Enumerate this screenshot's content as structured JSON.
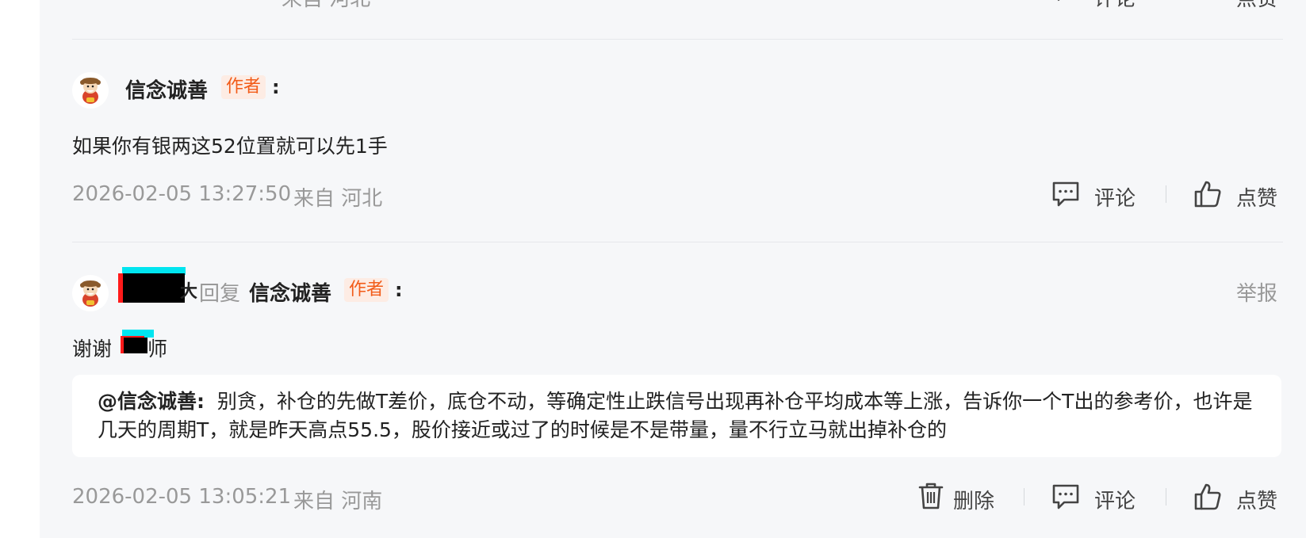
{
  "colors": {
    "badge_text": "#f25c19",
    "badge_bg": "#fdece4",
    "meta_gray": "#999999",
    "panel_bg": "#f6f7f9"
  },
  "top_partial": {
    "location_partial": "来自 河北",
    "comment_label": "评论",
    "like_label": "点赞"
  },
  "comments": [
    {
      "author": "信念诚善",
      "badge": "作者",
      "colon": ":",
      "content": "如果你有银两这52位置就可以先1手",
      "timestamp": "2026-02-05 13:27:50",
      "location": "来自 河北",
      "comment_label": "评论",
      "like_label": "点赞",
      "avatar_icon": "mascot-avatar-icon",
      "comment_icon": "chat-bubble-icon",
      "like_icon": "thumbs-up-icon"
    },
    {
      "author_suffix": "大",
      "reply_word": "回复",
      "reply_to": "信念诚善",
      "badge": "作者",
      "colon": ":",
      "report_label": "举报",
      "content_prefix": "谢谢",
      "content_suffix": "师",
      "quote_author": "@信念诚善:",
      "quote_text": "别贪，补仓的先做T差价，底仓不动，等确定性止跌信号出现再补仓平均成本等上涨，告诉你一个T出的参考价，也许是几天的周期T，就是昨天高点55.5，股价接近或过了的时候是不是带量，量不行立马就出掉补仓的",
      "timestamp": "2026-02-05 13:05:21",
      "location": "来自 河南",
      "delete_label": "删除",
      "comment_label": "评论",
      "like_label": "点赞",
      "avatar_icon": "mascot-avatar-icon",
      "delete_icon": "trash-icon",
      "comment_icon": "chat-bubble-icon",
      "like_icon": "thumbs-up-icon"
    }
  ]
}
